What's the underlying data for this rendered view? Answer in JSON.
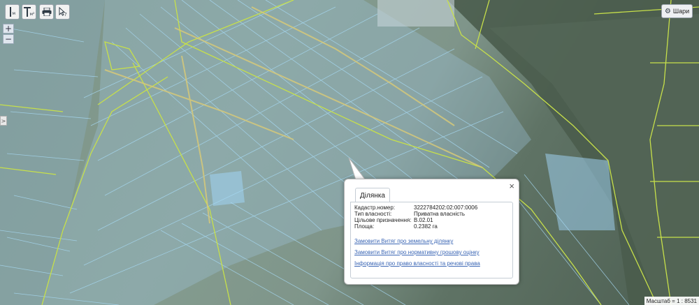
{
  "toolbar": {
    "measure_length": {
      "icon": "ruler-line-icon",
      "sub": "м"
    },
    "measure_area": {
      "icon": "ruler-area-icon",
      "sub": "м²"
    },
    "print": {
      "icon": "printer-icon"
    },
    "info": {
      "icon": "pointer-question-icon"
    }
  },
  "zoom": {
    "in": "+",
    "out": "−"
  },
  "sidebar_toggle": ">",
  "layers": {
    "label": "Шари",
    "icon": "gear-icon"
  },
  "popup": {
    "tab": "Ділянка",
    "close": "×",
    "fields": [
      {
        "label": "Кадастр.номер:",
        "value": "3222784202:02:007:0006"
      },
      {
        "label": "Тип власності:",
        "value": "Приватна власність"
      },
      {
        "label": "Цільове призначення:",
        "value": "В.02.01"
      },
      {
        "label": "Площа:",
        "value": "0.2382 га"
      }
    ],
    "links": [
      "Замовити Витяг про земельну ділянку",
      "Замовити Витяг про нормативну грошову оцінку",
      "Інформація про право власності та речові права"
    ]
  },
  "scale": "Масштаб = 1 : 8531",
  "colors": {
    "parcel": "#9fd0ee",
    "boundary": "#c7e04a",
    "road": "#c9c28a",
    "link": "#3c67b5"
  }
}
